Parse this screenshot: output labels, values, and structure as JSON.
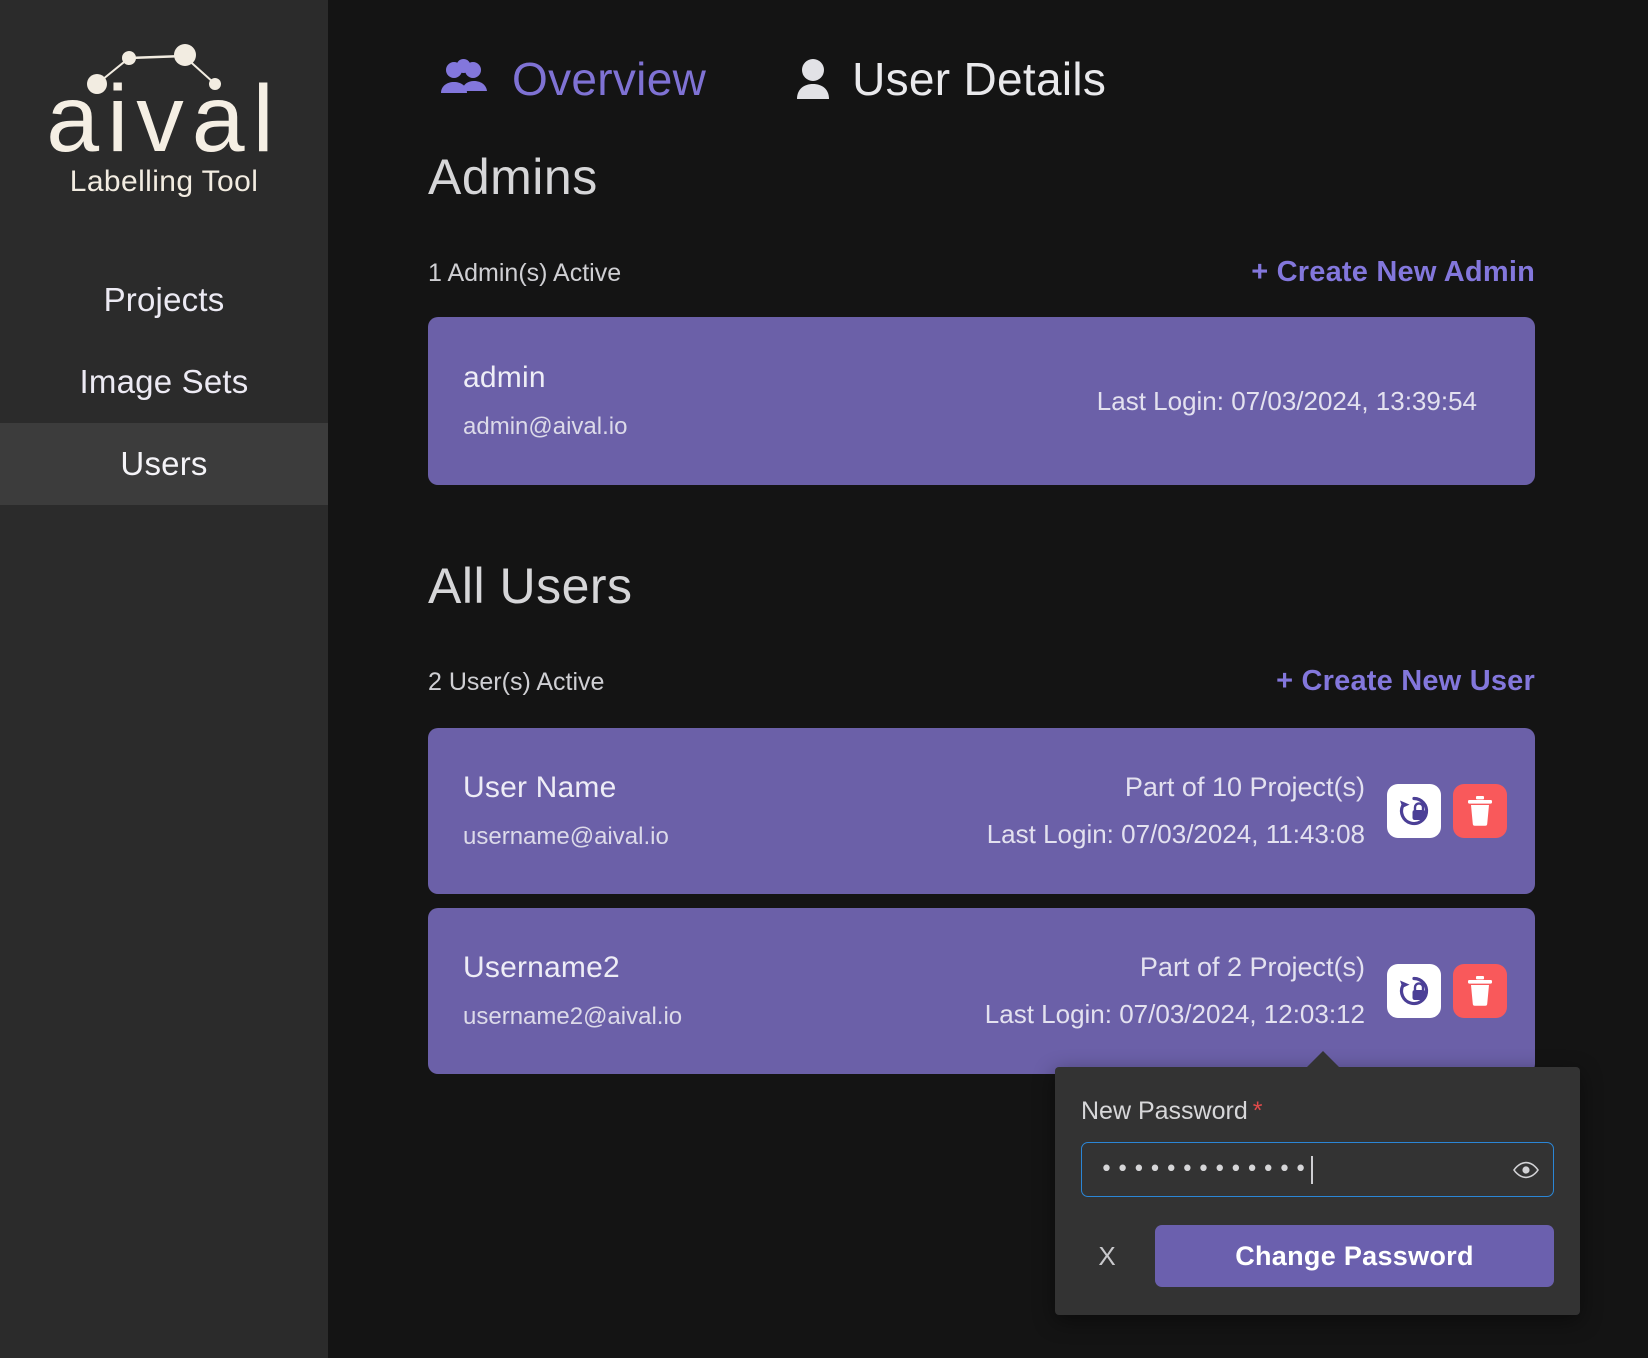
{
  "brand": {
    "name": "aival",
    "tagline": "Labelling Tool",
    "logo_icon": "network-nodes-icon"
  },
  "sidebar": {
    "items": [
      {
        "label": "Projects",
        "icon": "projects-icon",
        "active": false
      },
      {
        "label": "Image Sets",
        "icon": "image-sets-icon",
        "active": false
      },
      {
        "label": "Users",
        "icon": "users-icon",
        "active": true
      }
    ]
  },
  "tabs": [
    {
      "label": "Overview",
      "icon": "users-group-icon",
      "active": true
    },
    {
      "label": "User Details",
      "icon": "user-icon",
      "active": false
    }
  ],
  "admins_section": {
    "title": "Admins",
    "count_text": "1 Admin(s) Active",
    "create_label": "+ Create New Admin",
    "rows": [
      {
        "name": "admin",
        "email": "admin@aival.io",
        "last_login": "Last Login: 07/03/2024, 13:39:54"
      }
    ]
  },
  "users_section": {
    "title": "All Users",
    "count_text": "2 User(s) Active",
    "create_label": "+ Create New User",
    "rows": [
      {
        "name": "User Name",
        "email": "username@aival.io",
        "projects": "Part of 10 Project(s)",
        "last_login": "Last Login: 07/03/2024, 11:43:08",
        "reset_icon": "reset-password-icon",
        "delete_icon": "trash-icon"
      },
      {
        "name": "Username2",
        "email": "username2@aival.io",
        "projects": "Part of 2 Project(s)",
        "last_login": "Last Login: 07/03/2024, 12:03:12",
        "reset_icon": "reset-password-icon",
        "delete_icon": "trash-icon"
      }
    ]
  },
  "password_popover": {
    "label": "New Password",
    "required_marker": "*",
    "value": "•••••••••••••",
    "eye_icon": "eye-icon",
    "close_label": "X",
    "submit_label": "Change Password"
  },
  "colors": {
    "accent": "#7f72d4",
    "card": "#6b60a8",
    "danger": "#f9595b",
    "sidebar": "#2b2b2b",
    "background": "#141414",
    "popover": "#333333",
    "focus_border": "#2b86d6",
    "required": "#e04a4a"
  }
}
